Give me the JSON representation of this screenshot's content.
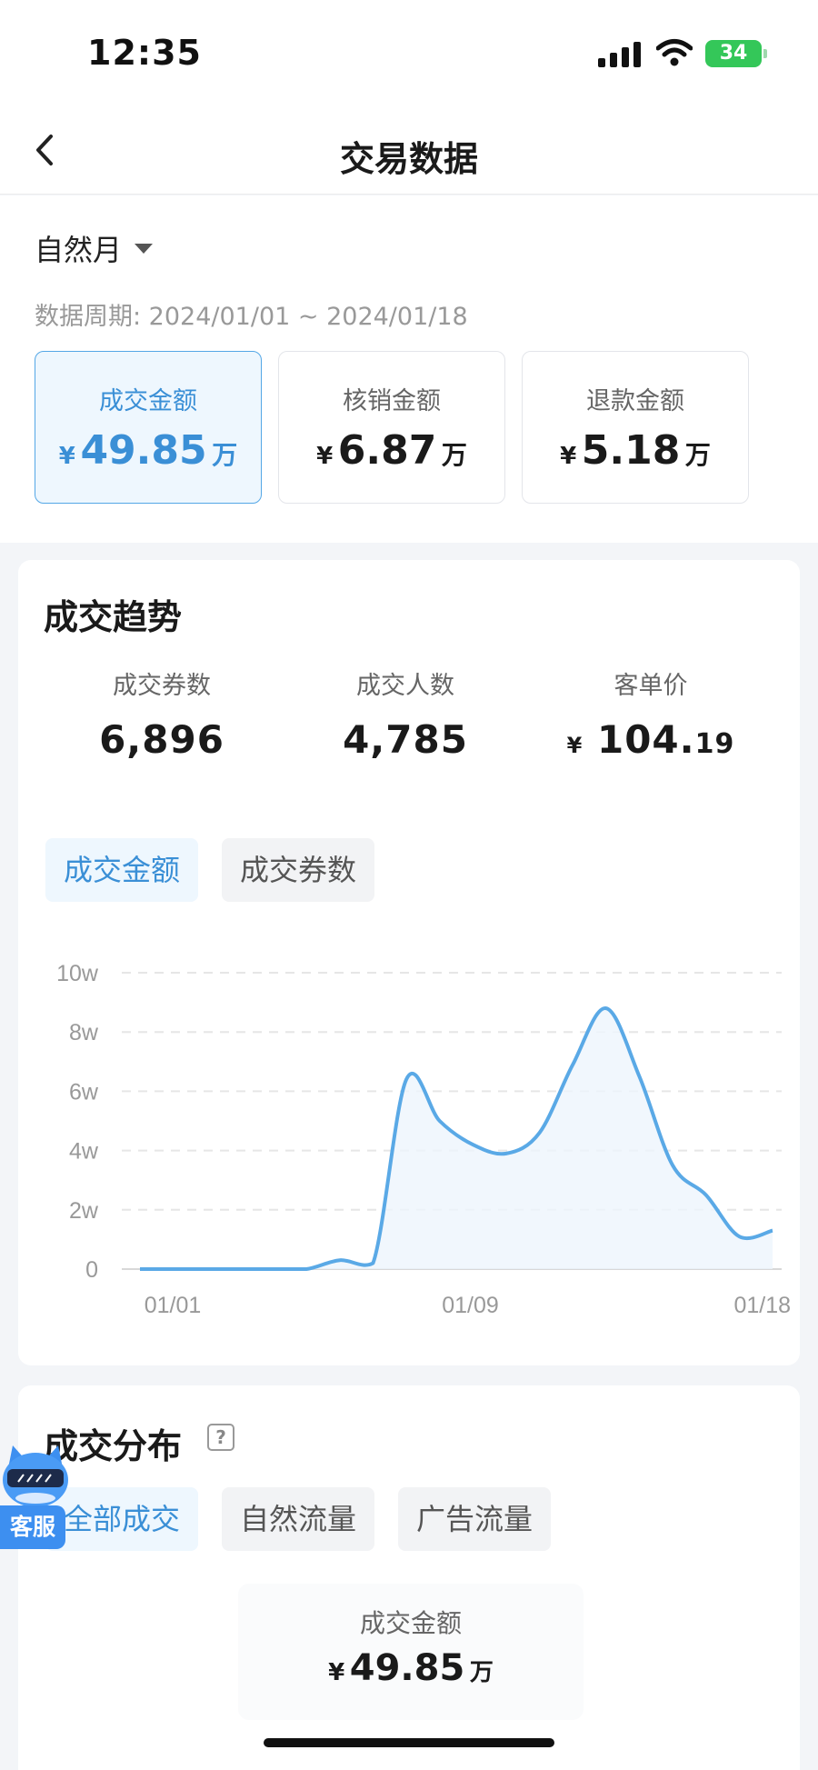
{
  "status_bar": {
    "time": "12:35",
    "battery": "34"
  },
  "nav": {
    "title": "交易数据"
  },
  "filter": {
    "period_type": "自然月",
    "period_range": "数据周期: 2024/01/01 ~ 2024/01/18"
  },
  "metric_cards": [
    {
      "label": "成交金额",
      "currency": "¥",
      "value": "49.85",
      "unit": "万",
      "active": true
    },
    {
      "label": "核销金额",
      "currency": "¥",
      "value": "6.87",
      "unit": "万",
      "active": false
    },
    {
      "label": "退款金额",
      "currency": "¥",
      "value": "5.18",
      "unit": "万",
      "active": false
    }
  ],
  "trend": {
    "title": "成交趋势",
    "stats": [
      {
        "label": "成交券数",
        "value": "6,896"
      },
      {
        "label": "成交人数",
        "value": "4,785"
      },
      {
        "label": "客单价",
        "currency": "¥",
        "value_int": "104.",
        "value_dec": "19"
      }
    ],
    "tabs": [
      {
        "label": "成交金额",
        "active": true
      },
      {
        "label": "成交券数",
        "active": false
      }
    ]
  },
  "chart_data": {
    "type": "area",
    "x_tick_labels": [
      "01/01",
      "01/09",
      "01/18"
    ],
    "y_tick_labels": [
      "0",
      "2w",
      "4w",
      "6w",
      "8w",
      "10w"
    ],
    "ylim": [
      0,
      10
    ],
    "grid": true,
    "line_color": "#5aa9e6",
    "series": [
      {
        "values": [
          0,
          0,
          0,
          0,
          0,
          0,
          0.3,
          0.2,
          6.4,
          5.0,
          4.2,
          3.9,
          4.6,
          6.9,
          8.8,
          6.5,
          3.5,
          2.5,
          1.1,
          1.3
        ]
      }
    ]
  },
  "distribution": {
    "title": "成交分布",
    "tabs": [
      {
        "label": "全部成交",
        "active": true
      },
      {
        "label": "自然流量",
        "active": false
      },
      {
        "label": "广告流量",
        "active": false
      }
    ],
    "summary": {
      "label": "成交金额",
      "currency": "¥",
      "value": "49.85",
      "unit": "万"
    }
  },
  "customer_service": {
    "label": "客服"
  },
  "colors": {
    "accent": "#3a8fd6",
    "active_bg": "#eef7fe",
    "battery": "#34c759"
  }
}
